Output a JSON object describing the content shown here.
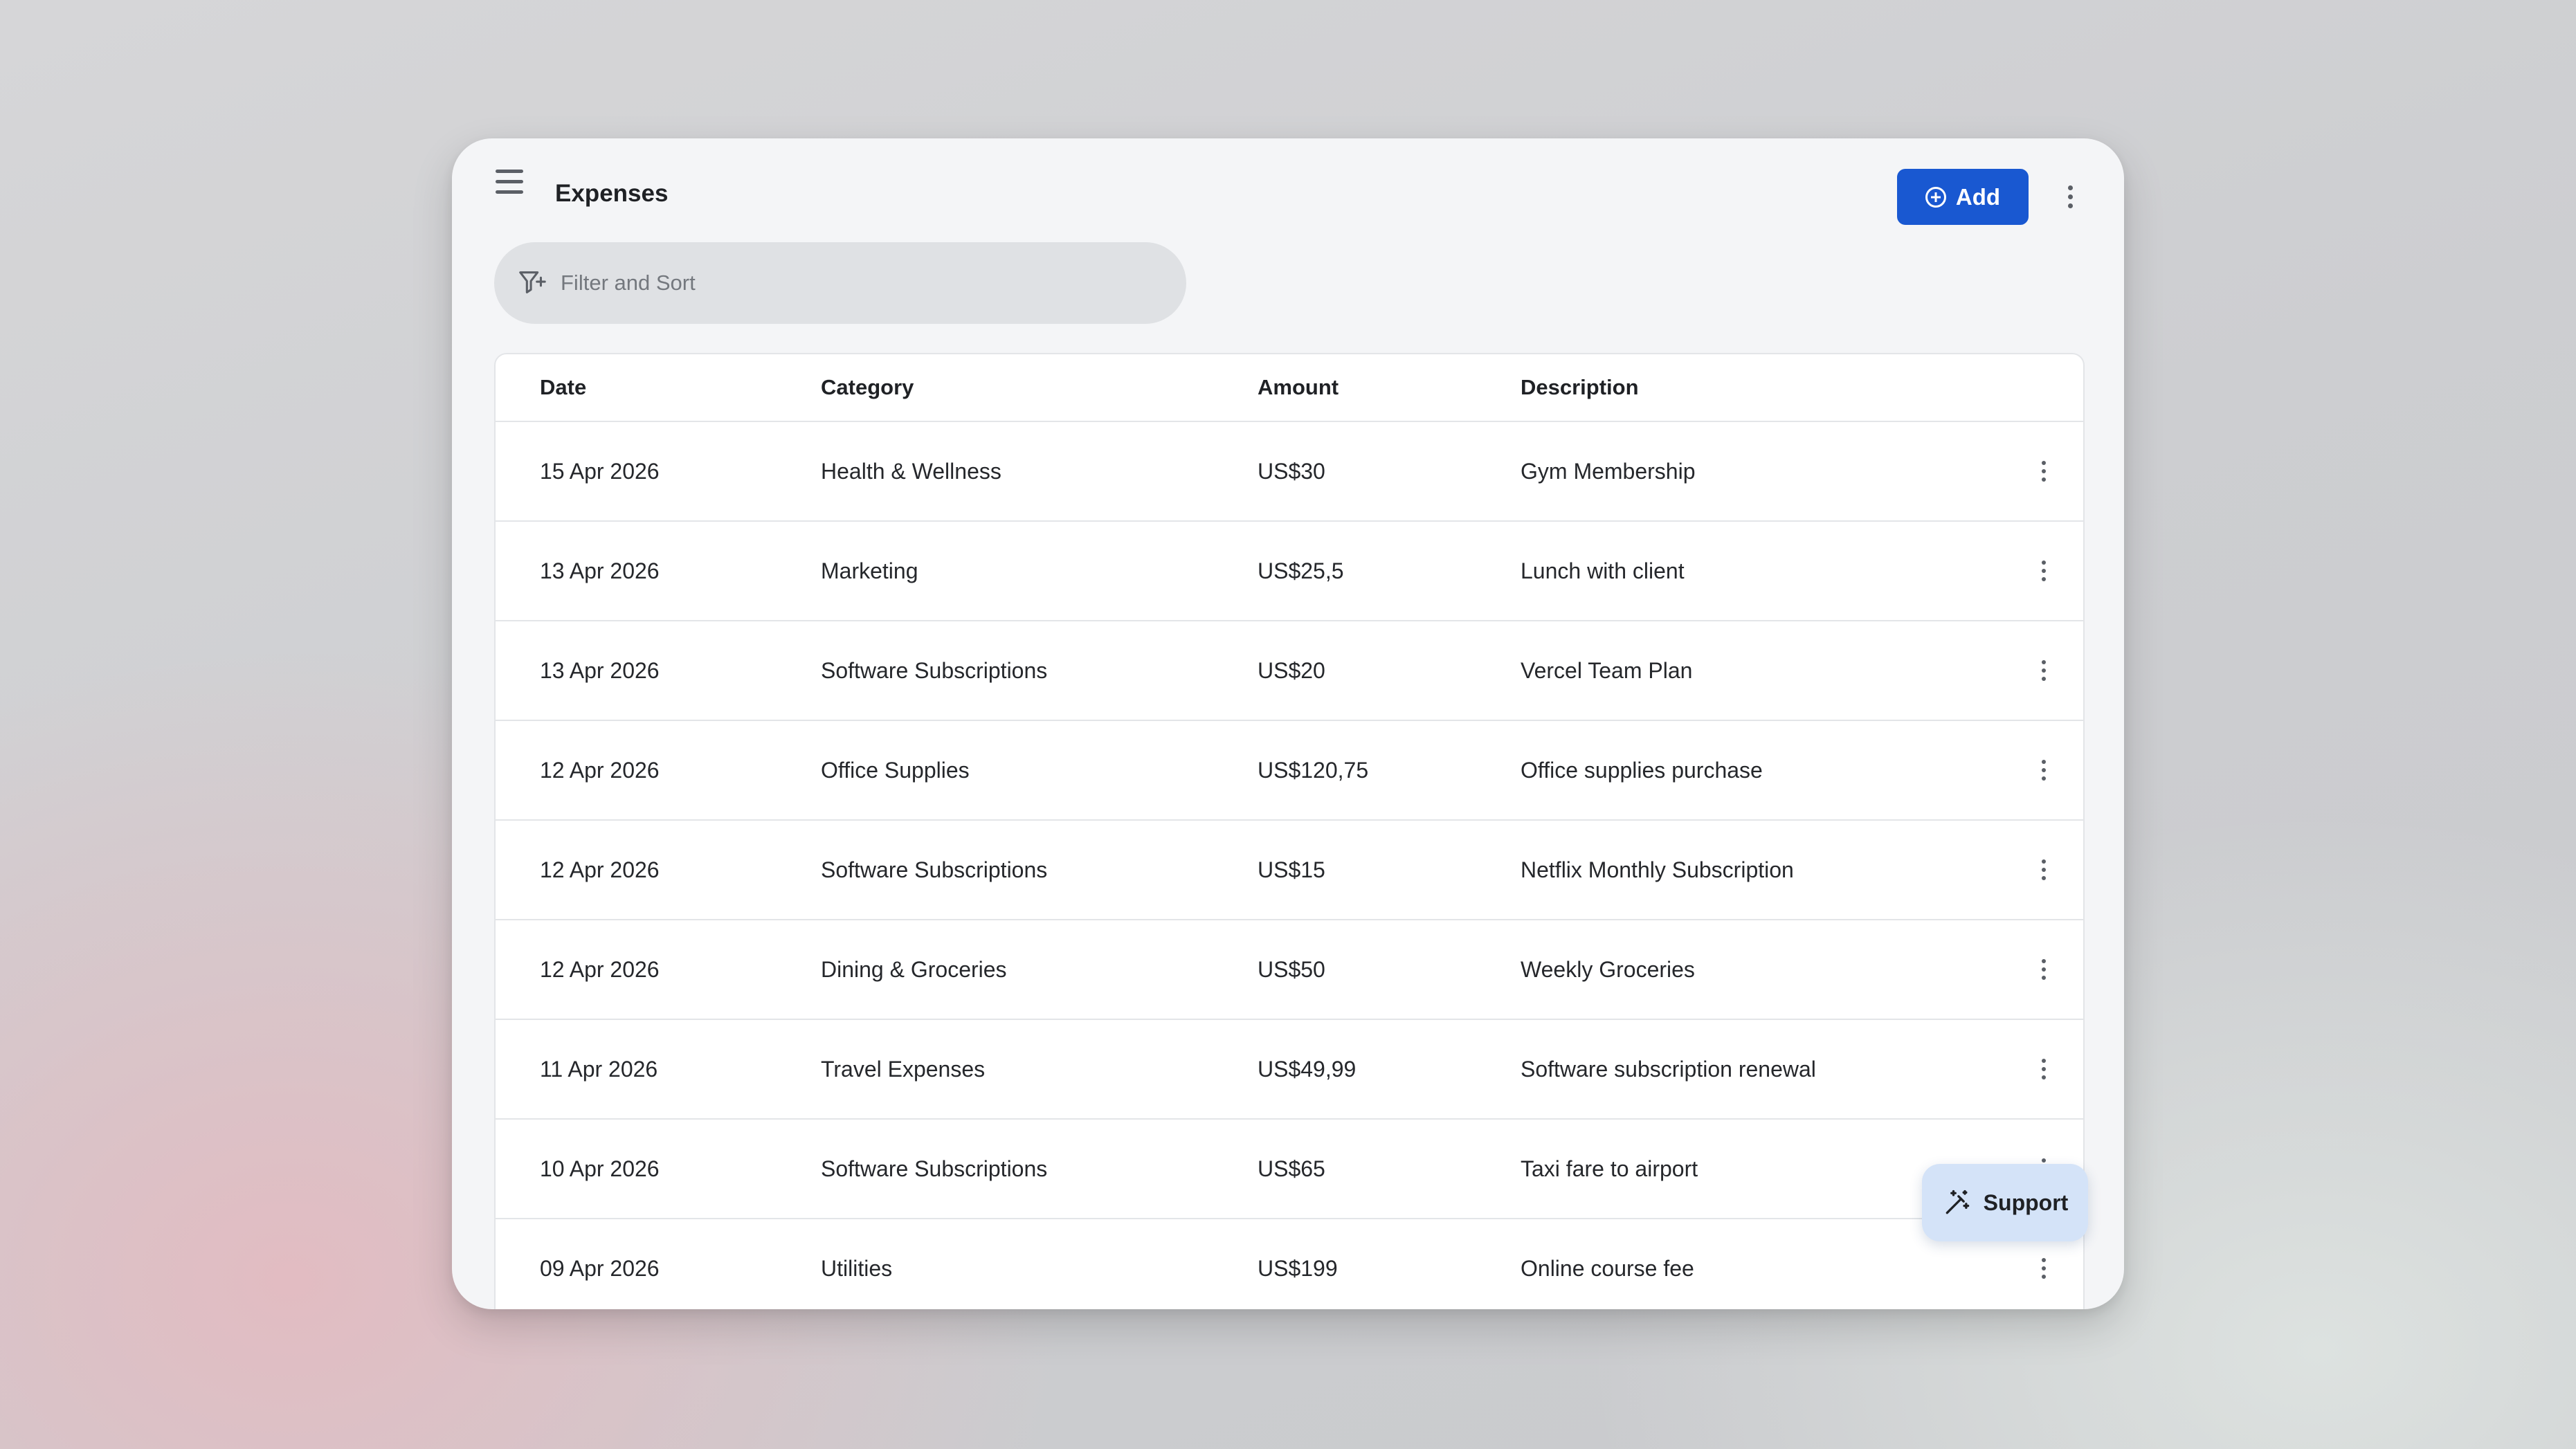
{
  "header": {
    "title": "Expenses",
    "add_label": "Add"
  },
  "filter": {
    "placeholder": "Filter and Sort"
  },
  "table": {
    "columns": [
      "Date",
      "Category",
      "Amount",
      "Description"
    ],
    "rows": [
      {
        "date": "15 Apr 2026",
        "category": "Health & Wellness",
        "amount": "US$30",
        "description": "Gym Membership"
      },
      {
        "date": "13 Apr 2026",
        "category": "Marketing",
        "amount": "US$25,5",
        "description": "Lunch with client"
      },
      {
        "date": "13 Apr 2026",
        "category": "Software Subscriptions",
        "amount": "US$20",
        "description": "Vercel Team Plan"
      },
      {
        "date": "12 Apr 2026",
        "category": "Office Supplies",
        "amount": "US$120,75",
        "description": "Office supplies purchase"
      },
      {
        "date": "12 Apr 2026",
        "category": "Software Subscriptions",
        "amount": "US$15",
        "description": "Netflix Monthly Subscription"
      },
      {
        "date": "12 Apr 2026",
        "category": "Dining & Groceries",
        "amount": "US$50",
        "description": "Weekly Groceries"
      },
      {
        "date": "11 Apr 2026",
        "category": "Travel Expenses",
        "amount": "US$49,99",
        "description": "Software subscription renewal"
      },
      {
        "date": "10 Apr 2026",
        "category": "Software Subscriptions",
        "amount": "US$65",
        "description": "Taxi fare to airport"
      },
      {
        "date": "09 Apr 2026",
        "category": "Utilities",
        "amount": "US$199",
        "description": "Online course fee"
      }
    ]
  },
  "support": {
    "label": "Support"
  },
  "icons": {
    "menu": "hamburger-menu-icon",
    "add": "plus-circle-icon",
    "more": "more-vertical-icon",
    "filter": "filter-sparkle-icon",
    "support": "magic-wand-icon"
  },
  "colors": {
    "accent": "#1958d1",
    "support_bg": "#d4e3f8"
  }
}
